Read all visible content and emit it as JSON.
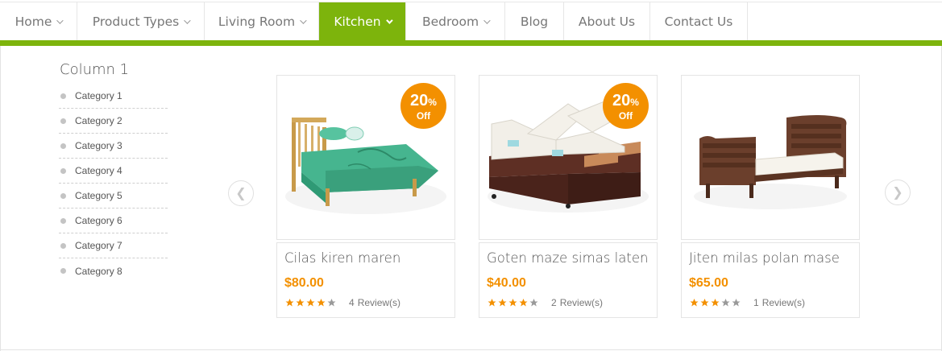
{
  "nav": {
    "items": [
      {
        "label": "Home",
        "dropdown": true,
        "active": false
      },
      {
        "label": "Product Types",
        "dropdown": true,
        "active": false
      },
      {
        "label": "Living Room",
        "dropdown": true,
        "active": false
      },
      {
        "label": "Kitchen",
        "dropdown": true,
        "active": true
      },
      {
        "label": "Bedroom",
        "dropdown": true,
        "active": false
      },
      {
        "label": "Blog",
        "dropdown": false,
        "active": false
      },
      {
        "label": "About Us",
        "dropdown": false,
        "active": false
      },
      {
        "label": "Contact Us",
        "dropdown": false,
        "active": false
      }
    ]
  },
  "menu": {
    "column_title": "Column 1",
    "categories": [
      "Category 1",
      "Category 2",
      "Category 3",
      "Category 4",
      "Category 5",
      "Category 6",
      "Category 7",
      "Category 8"
    ]
  },
  "carousel": {
    "prev_icon": "❮",
    "next_icon": "❯",
    "products": [
      {
        "name": "Cilas kiren maren",
        "price": "$80.00",
        "rating": 4,
        "reviews_count": "4",
        "reviews_label": "Review(s)",
        "badge": {
          "pct": "20",
          "pct_sign": "%",
          "off": "Off"
        },
        "image": "single-bed-green-icon"
      },
      {
        "name": "Goten maze simas laten",
        "price": "$40.00",
        "rating": 4,
        "reviews_count": "2",
        "reviews_label": "Review(s)",
        "badge": {
          "pct": "20",
          "pct_sign": "%",
          "off": "Off"
        },
        "image": "adjustable-double-bed-icon"
      },
      {
        "name": "Jiten milas polan mase",
        "price": "$65.00",
        "rating": 3,
        "reviews_count": "1",
        "reviews_label": "Review(s)",
        "badge": null,
        "image": "sleigh-bed-wood-icon"
      }
    ]
  },
  "colors": {
    "accent": "#7db40c",
    "price": "#f39000",
    "badge": "#f39000",
    "star_on": "#f39000",
    "star_off": "#9a9a9a"
  }
}
